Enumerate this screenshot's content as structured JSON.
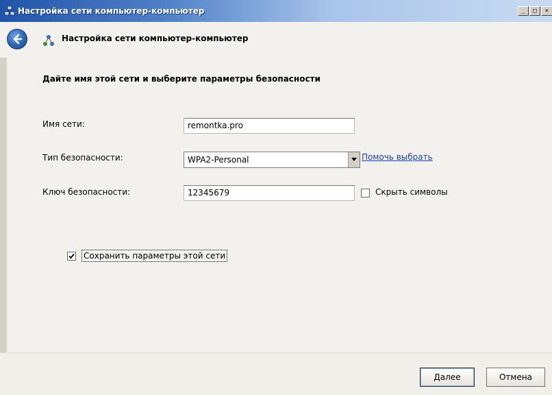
{
  "window": {
    "title": "Настройка сети компьютер-компьютер",
    "minimize_glyph": "_",
    "maximize_glyph": "□",
    "close_glyph": "×"
  },
  "header": {
    "title": "Настройка сети компьютер-компьютер"
  },
  "main": {
    "heading": "Дайте имя этой сети и выберите параметры безопасности",
    "network_name": {
      "label": "Имя сети:",
      "value": "remontka.pro"
    },
    "security_type": {
      "label": "Тип безопасности:",
      "selected": "WPA2-Personal",
      "help_link": "Помочь выбрать"
    },
    "security_key": {
      "label": "Ключ безопасности:",
      "value": "12345679",
      "hide_chars_label": "Скрыть символы",
      "hide_chars_checked": false
    },
    "save_settings": {
      "label": "Сохранить параметры этой сети",
      "checked": true
    }
  },
  "footer": {
    "next_label": "Далее",
    "cancel_label": "Отмена"
  },
  "colors": {
    "titlebar_start": "#2154a8",
    "link": "#1a3fb8",
    "content_bg": "#f2f1ed"
  },
  "icons": {
    "window_icon": "network-icon",
    "back": "back-arrow-icon",
    "header_icon": "network-icon",
    "dropdown": "chevron-down-icon",
    "check": "checkmark-icon"
  }
}
